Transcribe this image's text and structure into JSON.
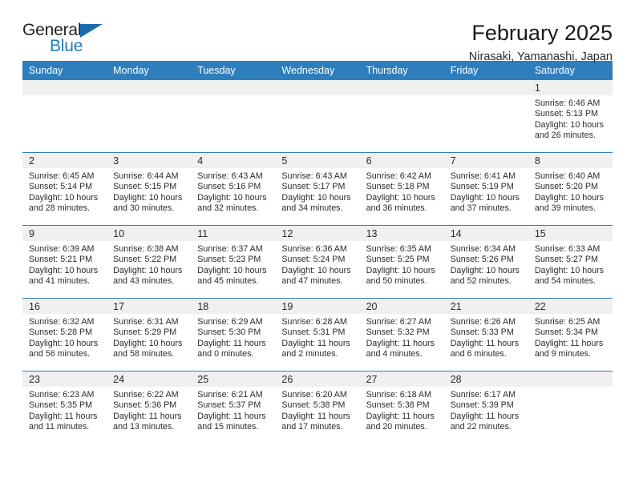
{
  "brand": {
    "name_top": "General",
    "name_bottom": "Blue",
    "accent_color": "#1f7bc1",
    "triangle_color": "#1b6cae"
  },
  "header": {
    "title": "February 2025",
    "subtitle": "Nirasaki, Yamanashi, Japan",
    "header_bg": "#2e7ebe",
    "daynum_bg": "#f0f0f0"
  },
  "weekday_headers": [
    "Sunday",
    "Monday",
    "Tuesday",
    "Wednesday",
    "Thursday",
    "Friday",
    "Saturday"
  ],
  "labels": {
    "sunrise": "Sunrise:",
    "sunset": "Sunset:",
    "daylight": "Daylight:"
  },
  "weeks": [
    [
      {
        "blank": true
      },
      {
        "blank": true
      },
      {
        "blank": true
      },
      {
        "blank": true
      },
      {
        "blank": true
      },
      {
        "blank": true
      },
      {
        "day": "1",
        "sunrise": "Sunrise: 6:46 AM",
        "sunset": "Sunset: 5:13 PM",
        "daylight_1": "Daylight: 10 hours",
        "daylight_2": "and 26 minutes."
      }
    ],
    [
      {
        "day": "2",
        "sunrise": "Sunrise: 6:45 AM",
        "sunset": "Sunset: 5:14 PM",
        "daylight_1": "Daylight: 10 hours",
        "daylight_2": "and 28 minutes."
      },
      {
        "day": "3",
        "sunrise": "Sunrise: 6:44 AM",
        "sunset": "Sunset: 5:15 PM",
        "daylight_1": "Daylight: 10 hours",
        "daylight_2": "and 30 minutes."
      },
      {
        "day": "4",
        "sunrise": "Sunrise: 6:43 AM",
        "sunset": "Sunset: 5:16 PM",
        "daylight_1": "Daylight: 10 hours",
        "daylight_2": "and 32 minutes."
      },
      {
        "day": "5",
        "sunrise": "Sunrise: 6:43 AM",
        "sunset": "Sunset: 5:17 PM",
        "daylight_1": "Daylight: 10 hours",
        "daylight_2": "and 34 minutes."
      },
      {
        "day": "6",
        "sunrise": "Sunrise: 6:42 AM",
        "sunset": "Sunset: 5:18 PM",
        "daylight_1": "Daylight: 10 hours",
        "daylight_2": "and 36 minutes."
      },
      {
        "day": "7",
        "sunrise": "Sunrise: 6:41 AM",
        "sunset": "Sunset: 5:19 PM",
        "daylight_1": "Daylight: 10 hours",
        "daylight_2": "and 37 minutes."
      },
      {
        "day": "8",
        "sunrise": "Sunrise: 6:40 AM",
        "sunset": "Sunset: 5:20 PM",
        "daylight_1": "Daylight: 10 hours",
        "daylight_2": "and 39 minutes."
      }
    ],
    [
      {
        "day": "9",
        "sunrise": "Sunrise: 6:39 AM",
        "sunset": "Sunset: 5:21 PM",
        "daylight_1": "Daylight: 10 hours",
        "daylight_2": "and 41 minutes."
      },
      {
        "day": "10",
        "sunrise": "Sunrise: 6:38 AM",
        "sunset": "Sunset: 5:22 PM",
        "daylight_1": "Daylight: 10 hours",
        "daylight_2": "and 43 minutes."
      },
      {
        "day": "11",
        "sunrise": "Sunrise: 6:37 AM",
        "sunset": "Sunset: 5:23 PM",
        "daylight_1": "Daylight: 10 hours",
        "daylight_2": "and 45 minutes."
      },
      {
        "day": "12",
        "sunrise": "Sunrise: 6:36 AM",
        "sunset": "Sunset: 5:24 PM",
        "daylight_1": "Daylight: 10 hours",
        "daylight_2": "and 47 minutes."
      },
      {
        "day": "13",
        "sunrise": "Sunrise: 6:35 AM",
        "sunset": "Sunset: 5:25 PM",
        "daylight_1": "Daylight: 10 hours",
        "daylight_2": "and 50 minutes."
      },
      {
        "day": "14",
        "sunrise": "Sunrise: 6:34 AM",
        "sunset": "Sunset: 5:26 PM",
        "daylight_1": "Daylight: 10 hours",
        "daylight_2": "and 52 minutes."
      },
      {
        "day": "15",
        "sunrise": "Sunrise: 6:33 AM",
        "sunset": "Sunset: 5:27 PM",
        "daylight_1": "Daylight: 10 hours",
        "daylight_2": "and 54 minutes."
      }
    ],
    [
      {
        "day": "16",
        "sunrise": "Sunrise: 6:32 AM",
        "sunset": "Sunset: 5:28 PM",
        "daylight_1": "Daylight: 10 hours",
        "daylight_2": "and 56 minutes."
      },
      {
        "day": "17",
        "sunrise": "Sunrise: 6:31 AM",
        "sunset": "Sunset: 5:29 PM",
        "daylight_1": "Daylight: 10 hours",
        "daylight_2": "and 58 minutes."
      },
      {
        "day": "18",
        "sunrise": "Sunrise: 6:29 AM",
        "sunset": "Sunset: 5:30 PM",
        "daylight_1": "Daylight: 11 hours",
        "daylight_2": "and 0 minutes."
      },
      {
        "day": "19",
        "sunrise": "Sunrise: 6:28 AM",
        "sunset": "Sunset: 5:31 PM",
        "daylight_1": "Daylight: 11 hours",
        "daylight_2": "and 2 minutes."
      },
      {
        "day": "20",
        "sunrise": "Sunrise: 6:27 AM",
        "sunset": "Sunset: 5:32 PM",
        "daylight_1": "Daylight: 11 hours",
        "daylight_2": "and 4 minutes."
      },
      {
        "day": "21",
        "sunrise": "Sunrise: 6:26 AM",
        "sunset": "Sunset: 5:33 PM",
        "daylight_1": "Daylight: 11 hours",
        "daylight_2": "and 6 minutes."
      },
      {
        "day": "22",
        "sunrise": "Sunrise: 6:25 AM",
        "sunset": "Sunset: 5:34 PM",
        "daylight_1": "Daylight: 11 hours",
        "daylight_2": "and 9 minutes."
      }
    ],
    [
      {
        "day": "23",
        "sunrise": "Sunrise: 6:23 AM",
        "sunset": "Sunset: 5:35 PM",
        "daylight_1": "Daylight: 11 hours",
        "daylight_2": "and 11 minutes."
      },
      {
        "day": "24",
        "sunrise": "Sunrise: 6:22 AM",
        "sunset": "Sunset: 5:36 PM",
        "daylight_1": "Daylight: 11 hours",
        "daylight_2": "and 13 minutes."
      },
      {
        "day": "25",
        "sunrise": "Sunrise: 6:21 AM",
        "sunset": "Sunset: 5:37 PM",
        "daylight_1": "Daylight: 11 hours",
        "daylight_2": "and 15 minutes."
      },
      {
        "day": "26",
        "sunrise": "Sunrise: 6:20 AM",
        "sunset": "Sunset: 5:38 PM",
        "daylight_1": "Daylight: 11 hours",
        "daylight_2": "and 17 minutes."
      },
      {
        "day": "27",
        "sunrise": "Sunrise: 6:18 AM",
        "sunset": "Sunset: 5:38 PM",
        "daylight_1": "Daylight: 11 hours",
        "daylight_2": "and 20 minutes."
      },
      {
        "day": "28",
        "sunrise": "Sunrise: 6:17 AM",
        "sunset": "Sunset: 5:39 PM",
        "daylight_1": "Daylight: 11 hours",
        "daylight_2": "and 22 minutes."
      },
      {
        "blank": true
      }
    ]
  ]
}
